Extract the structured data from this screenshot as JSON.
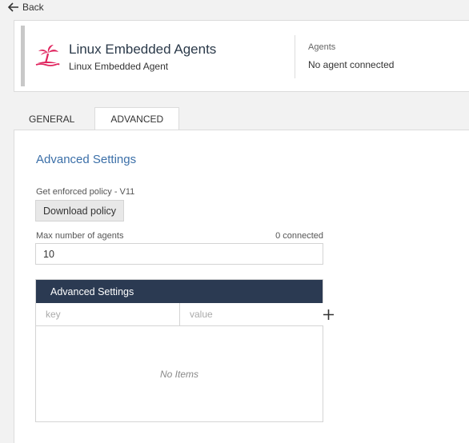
{
  "nav": {
    "back_label": "Back"
  },
  "header": {
    "title": "Linux Embedded Agents",
    "subtitle": "Linux Embedded Agent",
    "agents_label": "Agents",
    "agents_value": "No agent connected"
  },
  "tabs": [
    {
      "label": "GENERAL",
      "active": false
    },
    {
      "label": "ADVANCED",
      "active": true
    }
  ],
  "advanced": {
    "section_title": "Advanced Settings",
    "policy_label": "Get enforced policy - V11",
    "download_button": "Download policy",
    "max_agents_label": "Max number of agents",
    "connected_count": "0 connected",
    "max_agents_value": "10",
    "table": {
      "title": "Advanced Settings",
      "key_placeholder": "key",
      "value_placeholder": "value",
      "empty_text": "No Items"
    }
  },
  "colors": {
    "accent_link": "#3b6fa8",
    "table_header": "#2b3a52",
    "logo": "#e0245e"
  },
  "icons": [
    "arrow-left-icon",
    "palm-island-logo",
    "plus-icon"
  ]
}
